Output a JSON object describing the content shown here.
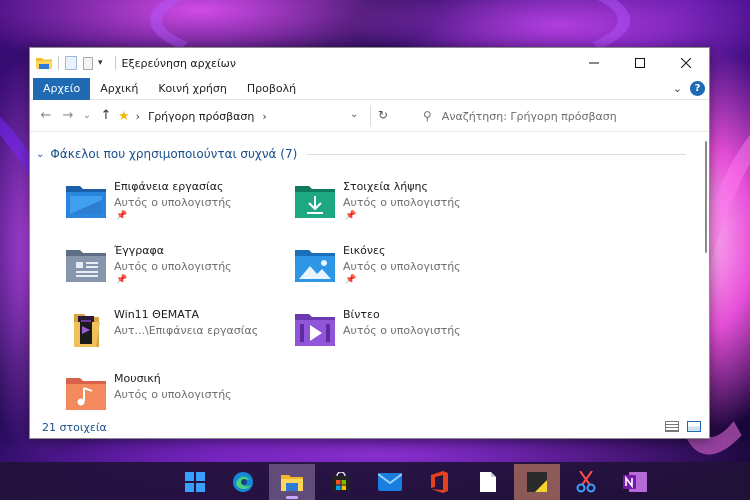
{
  "window": {
    "title": "Εξερεύνηση αρχείων",
    "controls": {
      "minimize": "—",
      "maximize": "☐",
      "close": "✕"
    }
  },
  "ribbon": {
    "tabs": [
      "Αρχείο",
      "Αρχική",
      "Κοινή χρήση",
      "Προβολή"
    ],
    "active_tab": "Αρχείο",
    "expand_glyph": "⌄",
    "help": "?"
  },
  "navigation": {
    "back": "←",
    "forward": "→",
    "recent": "⌄",
    "up": "↑",
    "address": "Γρήγορη πρόσβαση",
    "address_chevron": "›",
    "dropdown": "⌄",
    "refresh": "↻",
    "search_placeholder": "Αναζήτηση: Γρήγορη πρόσβαση"
  },
  "group": {
    "title": "Φάκελοι που χρησιμοποιούνται συχνά (7)",
    "chevron": "⌄"
  },
  "folders": [
    {
      "name": "Επιφάνεια εργασίας",
      "location": "Αυτός ο υπολογιστής",
      "pinned": true,
      "icon": "desktop-folder-icon"
    },
    {
      "name": "Στοιχεία λήψης",
      "location": "Αυτός ο υπολογιστής",
      "pinned": true,
      "icon": "downloads-folder-icon"
    },
    {
      "name": "Έγγραφα",
      "location": "Αυτός ο υπολογιστής",
      "pinned": true,
      "icon": "documents-folder-icon"
    },
    {
      "name": "Εικόνες",
      "location": "Αυτός ο υπολογιστής",
      "pinned": true,
      "icon": "pictures-folder-icon"
    },
    {
      "name": "Win11 ΘΕΜΑΤΑ",
      "location": "Αυτ...\\Επιφάνεια εργασίας",
      "pinned": false,
      "icon": "themes-folder-icon"
    },
    {
      "name": "Βίντεο",
      "location": "Αυτός ο υπολογιστής",
      "pinned": false,
      "icon": "videos-folder-icon"
    },
    {
      "name": "Μουσική",
      "location": "Αυτός ο υπολογιστής",
      "pinned": false,
      "icon": "music-folder-icon"
    }
  ],
  "status": {
    "items_text": "21 στοιχεία"
  },
  "taskbar": {
    "icons": [
      "start-icon",
      "edge-icon",
      "file-explorer-icon",
      "store-icon",
      "mail-icon",
      "office-icon",
      "notepad-icon",
      "sticky-notes-icon",
      "snipping-tool-icon",
      "onenote-icon"
    ]
  },
  "colors": {
    "accent": "#1f6ab3",
    "group_header": "#1a4f8b",
    "taskbar": "#22123a"
  }
}
